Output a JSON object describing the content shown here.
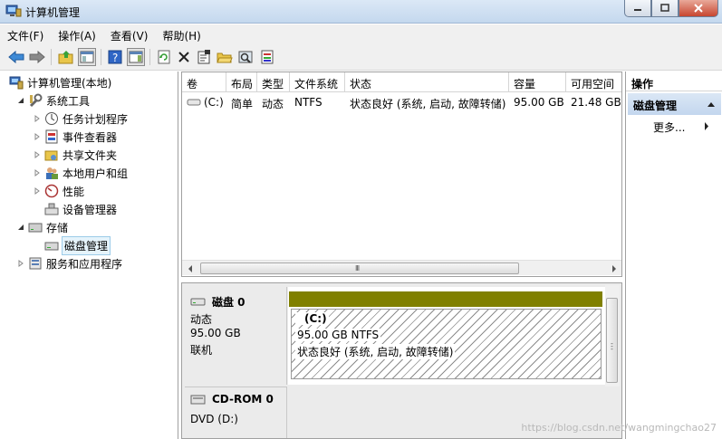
{
  "window": {
    "title": "计算机管理"
  },
  "menu": [
    "文件(F)",
    "操作(A)",
    "查看(V)",
    "帮助(H)"
  ],
  "toolbar": {
    "icons": [
      "back-arrow-icon",
      "forward-arrow-icon",
      "up-folder-icon",
      "show-hide-tree-icon",
      "help-icon",
      "show-action-pane-icon",
      "refresh-icon",
      "delete-icon",
      "properties-icon",
      "open-icon",
      "search-icon",
      "export-icon"
    ]
  },
  "tree": {
    "root": "计算机管理(本地)",
    "system_tools": "系统工具",
    "task_scheduler": "任务计划程序",
    "event_viewer": "事件查看器",
    "shared_folders": "共享文件夹",
    "local_users": "本地用户和组",
    "performance": "性能",
    "device_manager": "设备管理器",
    "storage": "存储",
    "disk_management": "磁盘管理",
    "services_apps": "服务和应用程序"
  },
  "volume_list": {
    "columns": [
      "卷",
      "布局",
      "类型",
      "文件系统",
      "状态",
      "容量",
      "可用空间"
    ],
    "rows": [
      {
        "volume": "(C:)",
        "layout": "简单",
        "type": "动态",
        "fs": "NTFS",
        "status": "状态良好 (系统, 启动, 故障转储)",
        "capacity": "95.00 GB",
        "free": "21.48 GB"
      }
    ]
  },
  "disks": {
    "disk0": {
      "name": "磁盘 0",
      "type": "动态",
      "size": "95.00 GB",
      "state": "联机",
      "volume_label": "(C:)",
      "volume_size_fs": "95.00 GB NTFS",
      "volume_status": "状态良好 (系统, 启动, 故障转储)",
      "bar_color": "#808000"
    },
    "cdrom": {
      "name": "CD-ROM 0",
      "type": "DVD (D:)"
    }
  },
  "actions": {
    "title": "操作",
    "section": "磁盘管理",
    "more": "更多..."
  },
  "watermark": "https://blog.csdn.net/wangmingchao27"
}
